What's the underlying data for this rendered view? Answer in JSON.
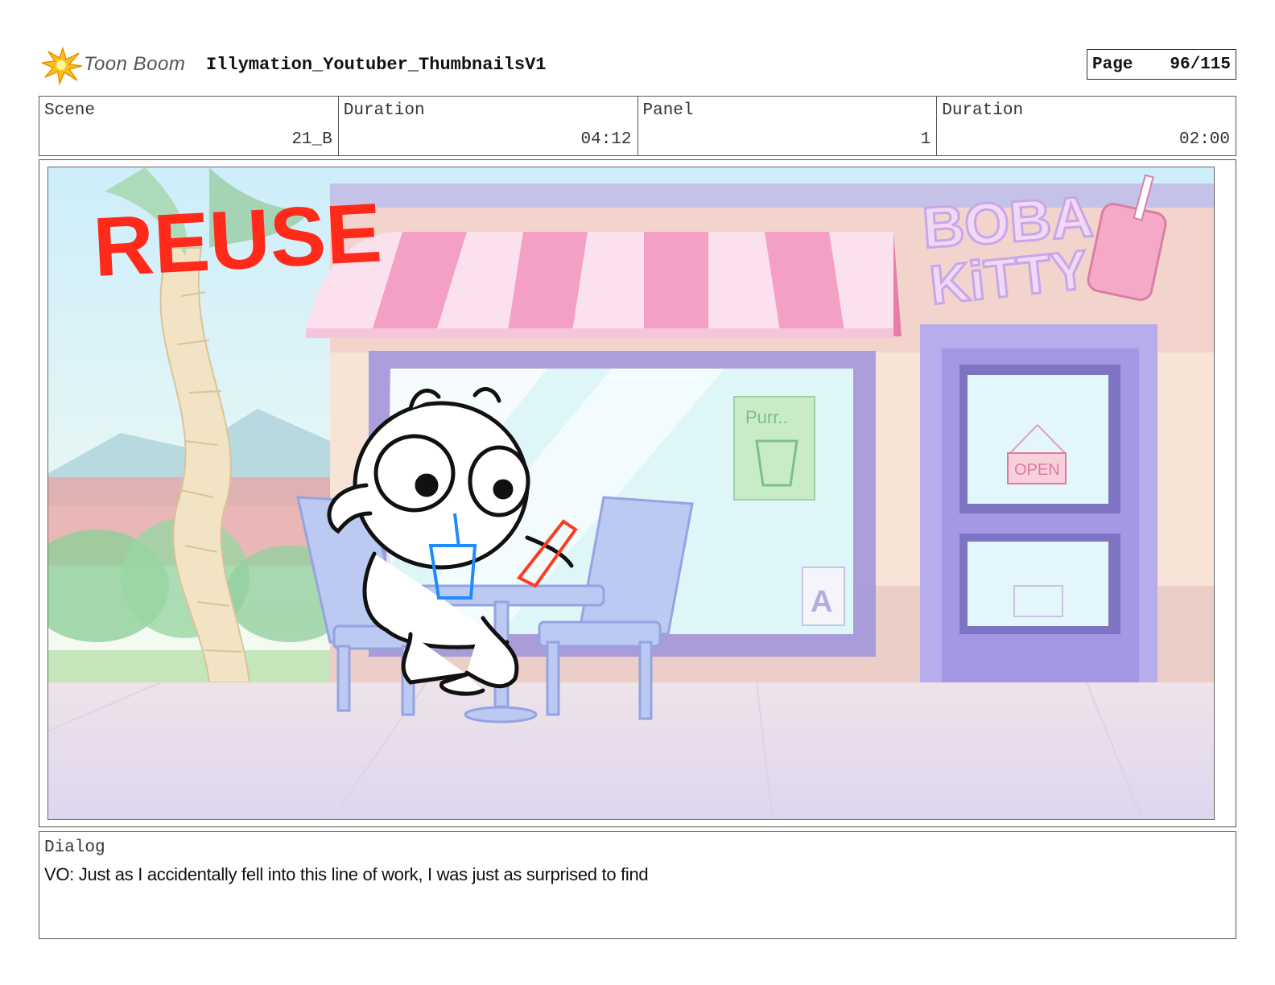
{
  "header": {
    "logo_text": "Toon Boom",
    "project_title": "Illymation_Youtuber_ThumbnailsV1",
    "page_label": "Page",
    "page_number": "96/115"
  },
  "info": {
    "scene_label": "Scene",
    "scene_value": "21_B",
    "scene_duration_label": "Duration",
    "scene_duration_value": "04:12",
    "panel_label": "Panel",
    "panel_value": "1",
    "panel_duration_label": "Duration",
    "panel_duration_value": "02:00"
  },
  "panel": {
    "reuse_text": "REUSE",
    "shop_sign_line1": "BOBA",
    "shop_sign_line2": "KiTTY",
    "door_sign": "OPEN",
    "window_poster": "Purr..",
    "a_frame_letter": "A"
  },
  "dialog": {
    "label": "Dialog",
    "text": "VO: Just as I accidentally fell into this line of work, I was just as surprised to find"
  },
  "colors": {
    "reuse_red": "#ff2a1a",
    "awning_pink": "#f3a0c4",
    "storefront_purple": "#a99ce0",
    "sky_blue": "#bfe6f5"
  }
}
